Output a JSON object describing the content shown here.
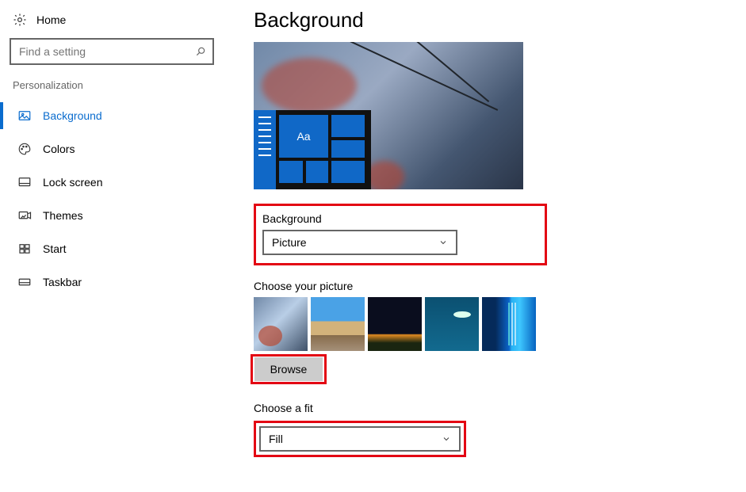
{
  "sidebar": {
    "home_label": "Home",
    "search_placeholder": "Find a setting",
    "section_label": "Personalization",
    "items": [
      {
        "label": "Background"
      },
      {
        "label": "Colors"
      },
      {
        "label": "Lock screen"
      },
      {
        "label": "Themes"
      },
      {
        "label": "Start"
      },
      {
        "label": "Taskbar"
      }
    ]
  },
  "main": {
    "title": "Background",
    "preview_tile_text": "Aa",
    "background_label": "Background",
    "background_value": "Picture",
    "choose_picture_label": "Choose your picture",
    "browse_label": "Browse",
    "fit_label": "Choose a fit",
    "fit_value": "Fill"
  }
}
